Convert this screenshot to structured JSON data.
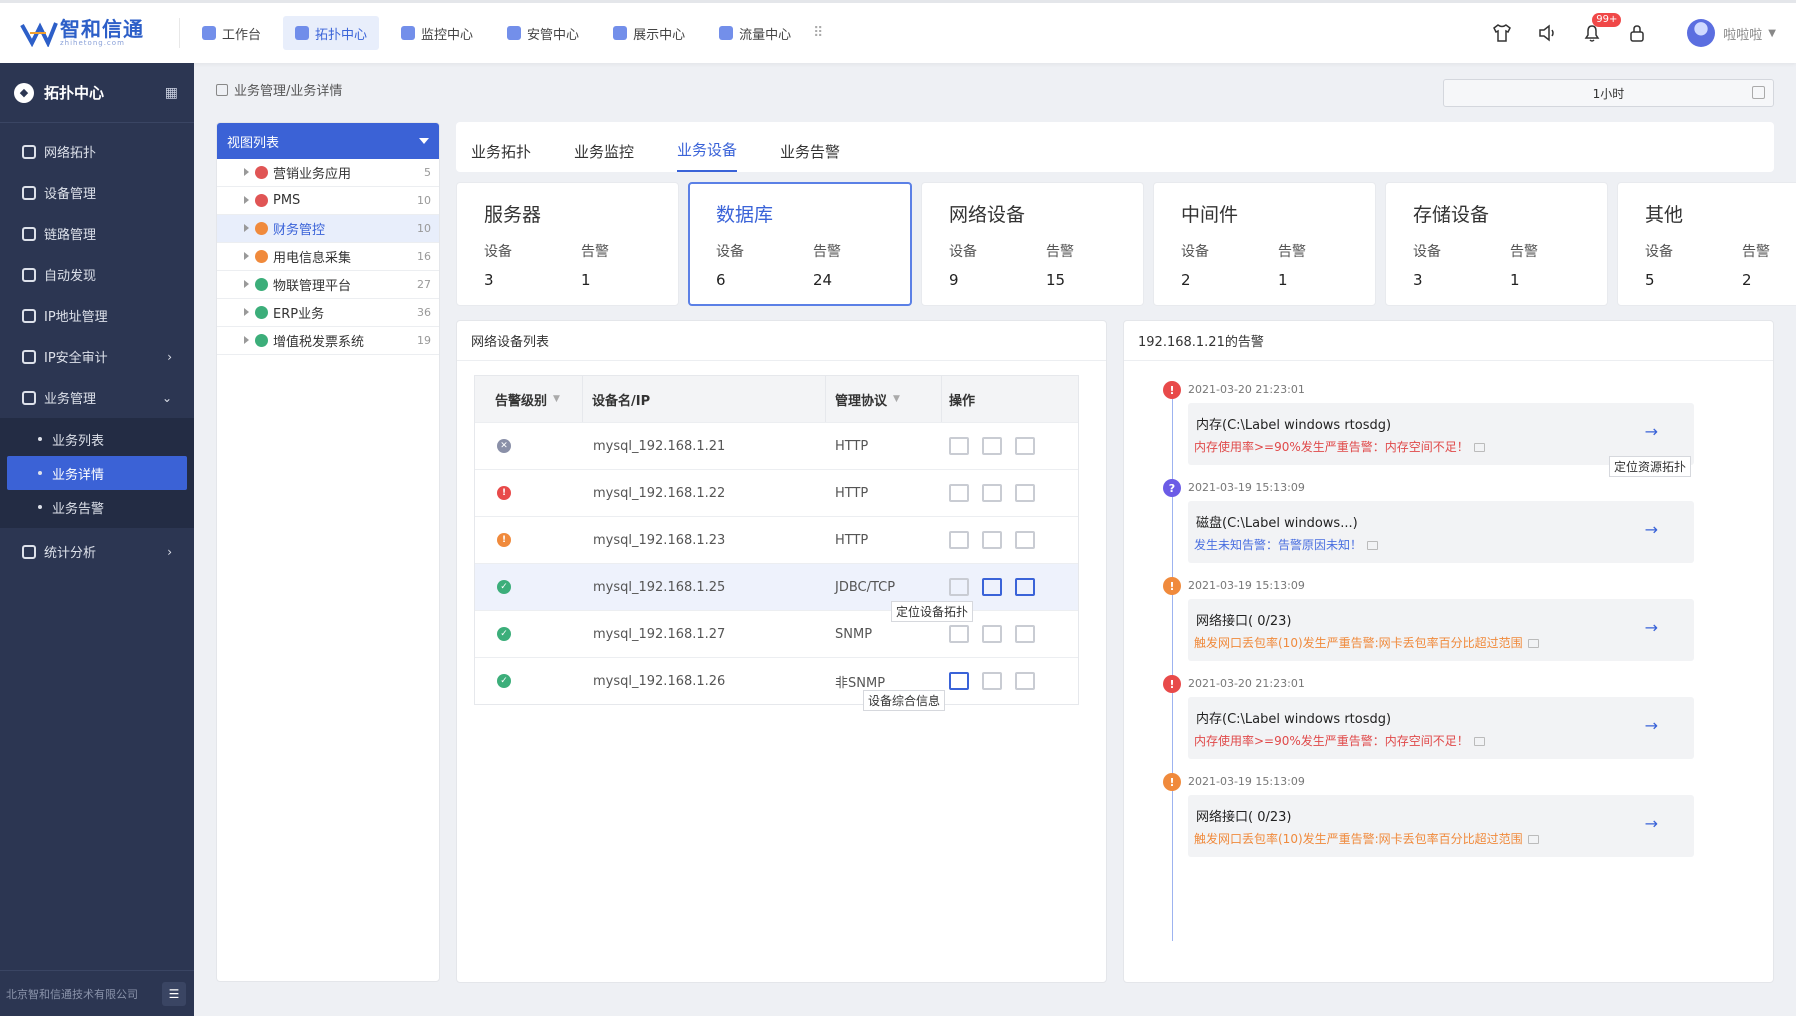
{
  "logo": {
    "name": "智和信通",
    "sub": "zhihetong.com"
  },
  "topnav": [
    {
      "label": "工作台",
      "active": false
    },
    {
      "label": "拓扑中心",
      "active": true
    },
    {
      "label": "监控中心",
      "active": false
    },
    {
      "label": "安管中心",
      "active": false
    },
    {
      "label": "展示中心",
      "active": false
    },
    {
      "label": "流量中心",
      "active": false
    }
  ],
  "topright": {
    "notif_badge": "99+",
    "user_name": "啦啦啦"
  },
  "sidebar": {
    "title": "拓扑中心",
    "items": [
      {
        "label": "网络拓扑"
      },
      {
        "label": "设备管理"
      },
      {
        "label": "链路管理"
      },
      {
        "label": "自动发现"
      },
      {
        "label": "IP地址管理"
      },
      {
        "label": "IP安全审计",
        "arrow": "›"
      },
      {
        "label": "业务管理",
        "arrow": "⌄"
      }
    ],
    "sub_items": [
      {
        "label": "业务列表",
        "active": false
      },
      {
        "label": "业务详情",
        "active": true
      },
      {
        "label": "业务告警",
        "active": false
      }
    ],
    "last_item": {
      "label": "统计分析",
      "arrow": "›"
    },
    "footer": "北京智和信通技术有限公司"
  },
  "breadcrumb": "业务管理/业务详情",
  "time_select": "1小时",
  "view_list": {
    "title": "视图列表",
    "rows": [
      {
        "label": "营销业务应用",
        "count": "5",
        "color": "#e05555",
        "active": false
      },
      {
        "label": "PMS",
        "count": "10",
        "color": "#e05555",
        "active": false
      },
      {
        "label": "财务管控",
        "count": "10",
        "color": "#f08a3c",
        "active": true
      },
      {
        "label": "用电信息采集",
        "count": "16",
        "color": "#f08a3c",
        "active": false
      },
      {
        "label": "物联管理平台",
        "count": "27",
        "color": "#3cae7a",
        "active": false
      },
      {
        "label": "ERP业务",
        "count": "36",
        "color": "#3cae7a",
        "active": false
      },
      {
        "label": "增值税发票系统",
        "count": "19",
        "color": "#3cae7a",
        "active": false
      }
    ]
  },
  "tabs": [
    {
      "label": "业务拓扑",
      "active": false
    },
    {
      "label": "业务监控",
      "active": false
    },
    {
      "label": "业务设备",
      "active": true
    },
    {
      "label": "业务告警",
      "active": false
    }
  ],
  "cards": [
    {
      "title": "服务器",
      "dev_label": "设备",
      "alarm_label": "告警",
      "dev": "3",
      "alarm": "1",
      "active": false
    },
    {
      "title": "数据库",
      "dev_label": "设备",
      "alarm_label": "告警",
      "dev": "6",
      "alarm": "24",
      "active": true
    },
    {
      "title": "网络设备",
      "dev_label": "设备",
      "alarm_label": "告警",
      "dev": "9",
      "alarm": "15",
      "active": false
    },
    {
      "title": "中间件",
      "dev_label": "设备",
      "alarm_label": "告警",
      "dev": "2",
      "alarm": "1",
      "active": false
    },
    {
      "title": "存储设备",
      "dev_label": "设备",
      "alarm_label": "告警",
      "dev": "3",
      "alarm": "1",
      "active": false
    },
    {
      "title": "其他",
      "dev_label": "设备",
      "alarm_label": "告警",
      "dev": "5",
      "alarm": "2",
      "active": false
    }
  ],
  "device_list": {
    "title": "网络设备列表",
    "headers": [
      "告警级别",
      "设备名/IP",
      "管理协议",
      "操作"
    ],
    "rows": [
      {
        "status": "unknown",
        "name": "mysql_192.168.1.21",
        "protocol": "HTTP",
        "highlight": false
      },
      {
        "status": "critical",
        "name": "mysql_192.168.1.22",
        "protocol": "HTTP",
        "highlight": false
      },
      {
        "status": "warning",
        "name": "mysql_192.168.1.23",
        "protocol": "HTTP",
        "highlight": false
      },
      {
        "status": "ok",
        "name": "mysql_192.168.1.25",
        "protocol": "JDBC/TCP",
        "highlight": true
      },
      {
        "status": "ok",
        "name": "mysql_192.168.1.27",
        "protocol": "SNMP",
        "highlight": false
      },
      {
        "status": "ok",
        "name": "mysql_192.168.1.26",
        "protocol": "非SNMP",
        "highlight": false
      }
    ],
    "tooltip_topo": "定位设备拓扑",
    "tooltip_info": "设备综合信息"
  },
  "alarms": {
    "title": "192.168.1.21的告警",
    "tooltip_res": "定位资源拓扑",
    "items": [
      {
        "level": "critical",
        "time": "2021-03-20 21:23:01",
        "title": "内存(C:\\Label windows rtosdg)",
        "desc": "内存使用率>=90%发生严重告警：内存空间不足！",
        "desc_color": "#e04a4a"
      },
      {
        "level": "unknown",
        "time": "2021-03-19 15:13:09",
        "title": "磁盘(C:\\Label windows...)",
        "desc": "发生未知告警：告警原因未知！",
        "desc_color": "#4a6fe0"
      },
      {
        "level": "warning",
        "time": "2021-03-19 15:13:09",
        "title": "网络接口( 0/23)",
        "desc": "触发网口丢包率(10)发生严重告警:网卡丢包率百分比超过范围",
        "desc_color": "#f08a3c"
      },
      {
        "level": "critical",
        "time": "2021-03-20 21:23:01",
        "title": "内存(C:\\Label windows rtosdg)",
        "desc": "内存使用率>=90%发生严重告警：内存空间不足！",
        "desc_color": "#e04a4a"
      },
      {
        "level": "warning",
        "time": "2021-03-19 15:13:09",
        "title": "网络接口( 0/23)",
        "desc": "触发网口丢包率(10)发生严重告警:网卡丢包率百分比超过范围",
        "desc_color": "#f08a3c"
      }
    ]
  },
  "colors": {
    "accent": "#3b62d6",
    "critical": "#e84a4a",
    "warning": "#f08a3c",
    "ok": "#3cae7a",
    "unknown": "#8a90a8",
    "question": "#6b5be6"
  }
}
